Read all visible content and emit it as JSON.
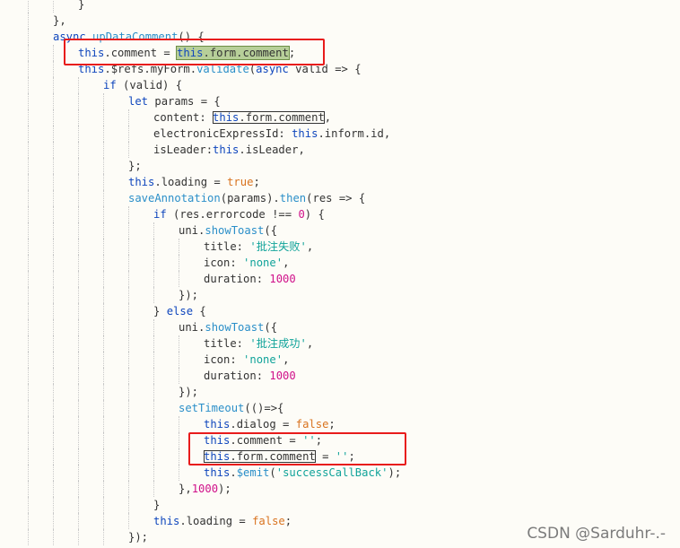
{
  "lines": [
    {
      "tokens": [
        {
          "t": "}",
          "c": "punc"
        }
      ]
    },
    {
      "tokens": [
        {
          "t": "},",
          "c": "punc"
        }
      ]
    },
    {
      "tokens": [
        {
          "t": "async ",
          "c": "kw"
        },
        {
          "t": "upDataComment",
          "c": "fn"
        },
        {
          "t": "() {",
          "c": "punc"
        }
      ]
    },
    {
      "tokens": [
        {
          "t": "this",
          "c": "this"
        },
        {
          "t": ".comment = ",
          "c": "punc"
        },
        {
          "t": "this.form.comment",
          "c": "hl",
          "inner": [
            {
              "t": "this",
              "c": "this"
            },
            {
              "t": ".form.comment",
              "c": "punc"
            }
          ]
        },
        {
          "t": ";",
          "c": "punc"
        }
      ]
    },
    {
      "tokens": [
        {
          "t": "this",
          "c": "this"
        },
        {
          "t": ".$refs.myForm.",
          "c": "punc"
        },
        {
          "t": "validate",
          "c": "fn"
        },
        {
          "t": "(",
          "c": "punc"
        },
        {
          "t": "async ",
          "c": "kw"
        },
        {
          "t": "valid => {",
          "c": "punc"
        }
      ]
    },
    {
      "tokens": [
        {
          "t": "if ",
          "c": "kw"
        },
        {
          "t": "(valid) {",
          "c": "punc"
        }
      ]
    },
    {
      "tokens": [
        {
          "t": "let ",
          "c": "kw"
        },
        {
          "t": "params = {",
          "c": "punc"
        }
      ]
    },
    {
      "tokens": [
        {
          "t": "content: ",
          "c": "punc"
        },
        {
          "t": "this.form.comment",
          "c": "box",
          "inner": [
            {
              "t": "this",
              "c": "this"
            },
            {
              "t": ".form.comment",
              "c": "punc"
            }
          ]
        },
        {
          "t": ",",
          "c": "punc"
        }
      ]
    },
    {
      "tokens": [
        {
          "t": "electronicExpressId: ",
          "c": "punc"
        },
        {
          "t": "this",
          "c": "this"
        },
        {
          "t": ".inform.id,",
          "c": "punc"
        }
      ]
    },
    {
      "tokens": [
        {
          "t": "isLeader:",
          "c": "punc"
        },
        {
          "t": "this",
          "c": "this"
        },
        {
          "t": ".isLeader,",
          "c": "punc"
        }
      ]
    },
    {
      "tokens": [
        {
          "t": "};",
          "c": "punc"
        }
      ]
    },
    {
      "tokens": [
        {
          "t": "this",
          "c": "this"
        },
        {
          "t": ".loading = ",
          "c": "punc"
        },
        {
          "t": "true",
          "c": "bool"
        },
        {
          "t": ";",
          "c": "punc"
        }
      ]
    },
    {
      "tokens": [
        {
          "t": "saveAnnotation",
          "c": "fn"
        },
        {
          "t": "(params).",
          "c": "punc"
        },
        {
          "t": "then",
          "c": "fn"
        },
        {
          "t": "(res => {",
          "c": "punc"
        }
      ]
    },
    {
      "tokens": [
        {
          "t": "if ",
          "c": "kw"
        },
        {
          "t": "(res.errorcode !== ",
          "c": "punc"
        },
        {
          "t": "0",
          "c": "num"
        },
        {
          "t": ") {",
          "c": "punc"
        }
      ]
    },
    {
      "tokens": [
        {
          "t": "uni.",
          "c": "punc"
        },
        {
          "t": "showToast",
          "c": "fn"
        },
        {
          "t": "({",
          "c": "punc"
        }
      ]
    },
    {
      "tokens": [
        {
          "t": "title: ",
          "c": "punc"
        },
        {
          "t": "'批注失败'",
          "c": "str"
        },
        {
          "t": ",",
          "c": "punc"
        }
      ]
    },
    {
      "tokens": [
        {
          "t": "icon: ",
          "c": "punc"
        },
        {
          "t": "'none'",
          "c": "str"
        },
        {
          "t": ",",
          "c": "punc"
        }
      ]
    },
    {
      "tokens": [
        {
          "t": "duration: ",
          "c": "punc"
        },
        {
          "t": "1000",
          "c": "num"
        }
      ]
    },
    {
      "tokens": [
        {
          "t": "});",
          "c": "punc"
        }
      ]
    },
    {
      "tokens": [
        {
          "t": "} ",
          "c": "punc"
        },
        {
          "t": "else ",
          "c": "kw"
        },
        {
          "t": "{",
          "c": "punc"
        }
      ]
    },
    {
      "tokens": [
        {
          "t": "uni.",
          "c": "punc"
        },
        {
          "t": "showToast",
          "c": "fn"
        },
        {
          "t": "({",
          "c": "punc"
        }
      ]
    },
    {
      "tokens": [
        {
          "t": "title: ",
          "c": "punc"
        },
        {
          "t": "'批注成功'",
          "c": "str"
        },
        {
          "t": ",",
          "c": "punc"
        }
      ]
    },
    {
      "tokens": [
        {
          "t": "icon: ",
          "c": "punc"
        },
        {
          "t": "'none'",
          "c": "str"
        },
        {
          "t": ",",
          "c": "punc"
        }
      ]
    },
    {
      "tokens": [
        {
          "t": "duration: ",
          "c": "punc"
        },
        {
          "t": "1000",
          "c": "num"
        }
      ]
    },
    {
      "tokens": [
        {
          "t": "});",
          "c": "punc"
        }
      ]
    },
    {
      "tokens": [
        {
          "t": "setTimeout",
          "c": "fn"
        },
        {
          "t": "(()=>{",
          "c": "punc"
        }
      ]
    },
    {
      "tokens": [
        {
          "t": "this",
          "c": "this"
        },
        {
          "t": ".dialog = ",
          "c": "punc"
        },
        {
          "t": "false",
          "c": "bool"
        },
        {
          "t": ";",
          "c": "punc"
        }
      ]
    },
    {
      "tokens": [
        {
          "t": "this",
          "c": "this"
        },
        {
          "t": ".comment = ",
          "c": "punc"
        },
        {
          "t": "''",
          "c": "str"
        },
        {
          "t": ";",
          "c": "punc"
        }
      ]
    },
    {
      "tokens": [
        {
          "t": "this.form.comment",
          "c": "box",
          "inner": [
            {
              "t": "this",
              "c": "this"
            },
            {
              "t": ".form.comment",
              "c": "punc"
            }
          ]
        },
        {
          "t": " = ",
          "c": "punc"
        },
        {
          "t": "''",
          "c": "str"
        },
        {
          "t": ";",
          "c": "punc"
        }
      ]
    },
    {
      "tokens": [
        {
          "t": "this",
          "c": "this"
        },
        {
          "t": ".",
          "c": "punc"
        },
        {
          "t": "$emit",
          "c": "fn"
        },
        {
          "t": "(",
          "c": "punc"
        },
        {
          "t": "'successCallBack'",
          "c": "str"
        },
        {
          "t": ");",
          "c": "punc"
        }
      ]
    },
    {
      "tokens": [
        {
          "t": "},",
          "c": "punc"
        },
        {
          "t": "1000",
          "c": "num"
        },
        {
          "t": ");",
          "c": "punc"
        }
      ]
    },
    {
      "tokens": [
        {
          "t": "}",
          "c": "punc"
        }
      ]
    },
    {
      "tokens": [
        {
          "t": "this",
          "c": "this"
        },
        {
          "t": ".loading = ",
          "c": "punc"
        },
        {
          "t": "false",
          "c": "bool"
        },
        {
          "t": ";",
          "c": "punc"
        }
      ]
    },
    {
      "tokens": [
        {
          "t": "});",
          "c": "punc"
        }
      ]
    }
  ],
  "watermark": "CSDN @Sarduhr-.-",
  "colors": {
    "keyword": "#0f46bd",
    "function": "#2b8fc9",
    "string": "#10a39a",
    "number": "#d0118a",
    "boolean": "#d9731f",
    "annotation_box": "#e81b1b",
    "selection_highlight": "#b7cf99"
  }
}
